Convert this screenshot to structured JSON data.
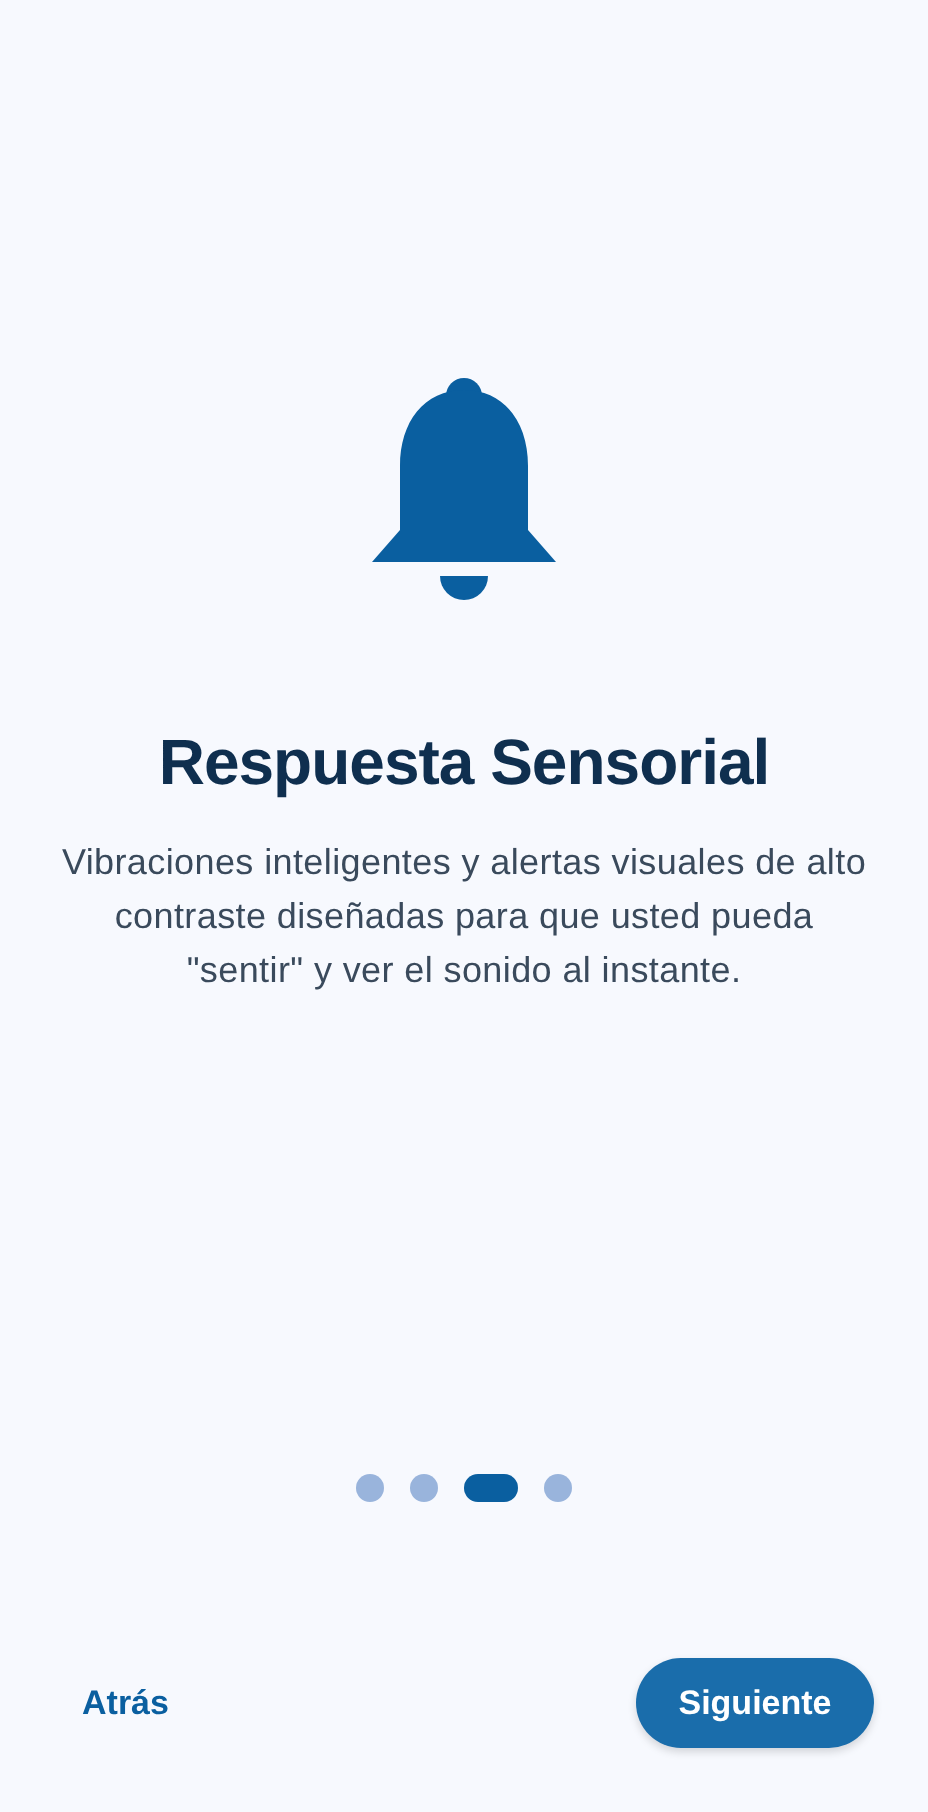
{
  "title": "Respuesta Sensorial",
  "description": "Vibraciones inteligentes y alertas visuales de alto contraste diseñadas para que usted pueda \"sentir\" y ver el sonido al instante.",
  "pager": [
    {
      "selected": false
    },
    {
      "selected": false
    },
    {
      "selected": true
    },
    {
      "selected": false
    }
  ],
  "buttons": {
    "back": "Atrás",
    "next": "Siguiente"
  }
}
